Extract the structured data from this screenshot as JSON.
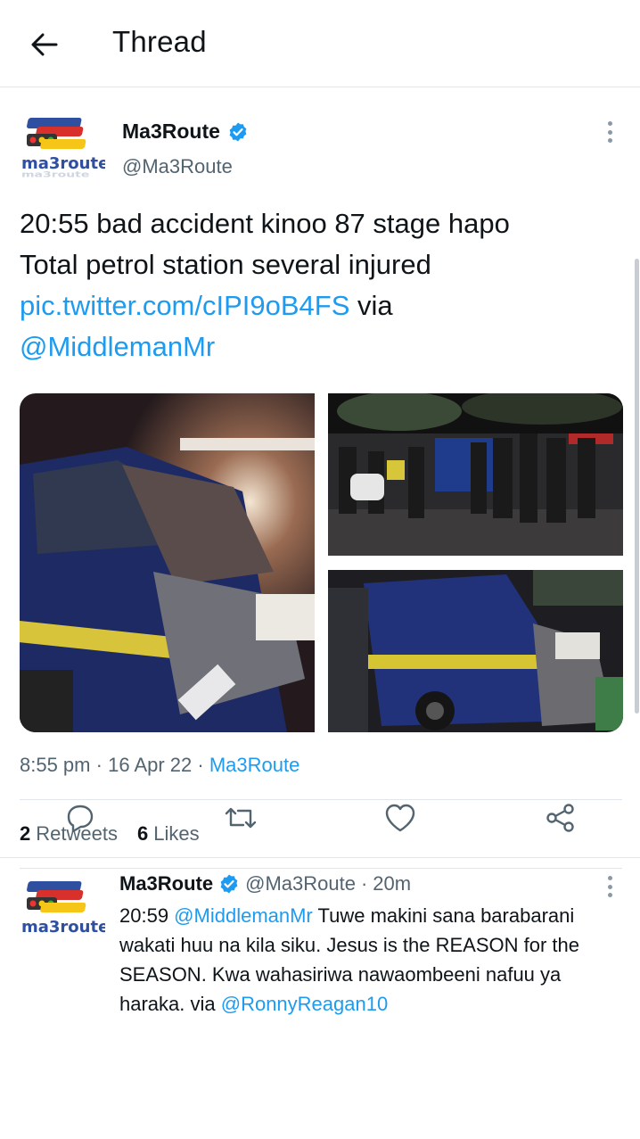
{
  "header": {
    "title": "Thread",
    "back_icon": "arrow-left-icon"
  },
  "main_tweet": {
    "author_name": "Ma3Route",
    "author_handle": "@Ma3Route",
    "logo_text": "ma3route",
    "text_line1": "20:55 bad accident kinoo 87 stage hapo",
    "text_line2": "Total petrol station several injured",
    "link": "pic.twitter.com/cIPI9oB4FS",
    "via_word": " via",
    "mention": "@MiddlemanMr",
    "time": "8:55 pm",
    "date": "16 Apr 22",
    "source": "Ma3Route",
    "retweets_count": "2",
    "retweets_label": "Retweets",
    "likes_count": "6",
    "likes_label": "Likes",
    "media": [
      "accident-photo-1",
      "accident-photo-2",
      "accident-photo-3"
    ]
  },
  "reply_tweet": {
    "author_name": "Ma3Route",
    "author_handle": "@Ma3Route",
    "age": "20m",
    "time_prefix": "20:59 ",
    "mention": "@MiddlemanMr",
    "text": " Tuwe makini sana barabarani wakati huu na kila siku. Jesus is the REASON for the SEASON. Kwa wahasiriwa nawaombeeni nafuu ya haraka. via ",
    "mention2": "@RonnyReagan10"
  },
  "colors": {
    "link": "#1d9bf0",
    "secondary_text": "#536471",
    "verified": "#1d9bf0",
    "divider": "#e1e6ea"
  }
}
